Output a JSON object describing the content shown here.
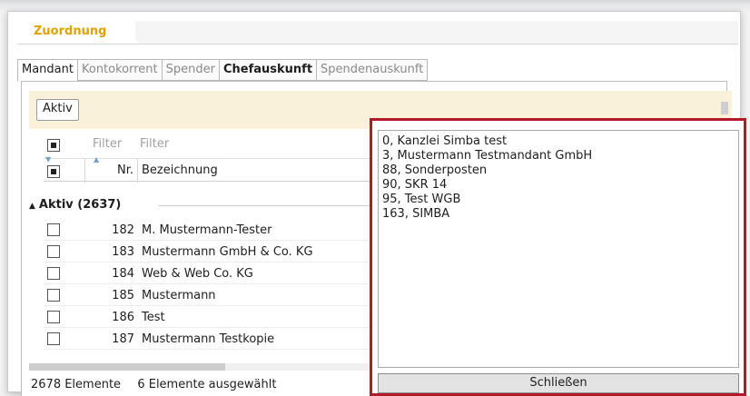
{
  "section": {
    "title": "Zuordnung"
  },
  "tabs": [
    {
      "label": "Mandant",
      "active": true
    },
    {
      "label": "Kontokorrent"
    },
    {
      "label": "Spender"
    },
    {
      "label": "Chefauskunft",
      "bold": true
    },
    {
      "label": "Spendenauskunft"
    }
  ],
  "filterbar": {
    "aktiv_label": "Aktiv"
  },
  "grid": {
    "filter_row": {
      "nr_placeholder": "Filter",
      "bez_placeholder": "Filter"
    },
    "headers": {
      "nr": "Nr.",
      "bezeichnung": "Bezeichnung"
    },
    "group": {
      "label": "Aktiv (2637)"
    },
    "rows": [
      {
        "nr": "182",
        "bezeichnung": "M. Mustermann-Tester"
      },
      {
        "nr": "183",
        "bezeichnung": "Mustermann GmbH & Co. KG"
      },
      {
        "nr": "184",
        "bezeichnung": "Web & Web Co. KG"
      },
      {
        "nr": "185",
        "bezeichnung": "Mustermann"
      },
      {
        "nr": "186",
        "bezeichnung": "Test"
      },
      {
        "nr": "187",
        "bezeichnung": "Mustermann Testkopie"
      }
    ]
  },
  "status": {
    "count": "2678 Elemente",
    "selected": "6 Elemente ausgewählt"
  },
  "popup": {
    "items": [
      "0, Kanzlei Simba test",
      "3, Mustermann Testmandant GmbH",
      "88, Sonderposten",
      "90, SKR 14",
      "95, Test WGB",
      "163, SIMBA"
    ],
    "close_label": "Schließen"
  },
  "colors": {
    "accent": "#e1a100",
    "popup_border": "#b21a2a",
    "filter_bg": "#f9f1d9"
  }
}
